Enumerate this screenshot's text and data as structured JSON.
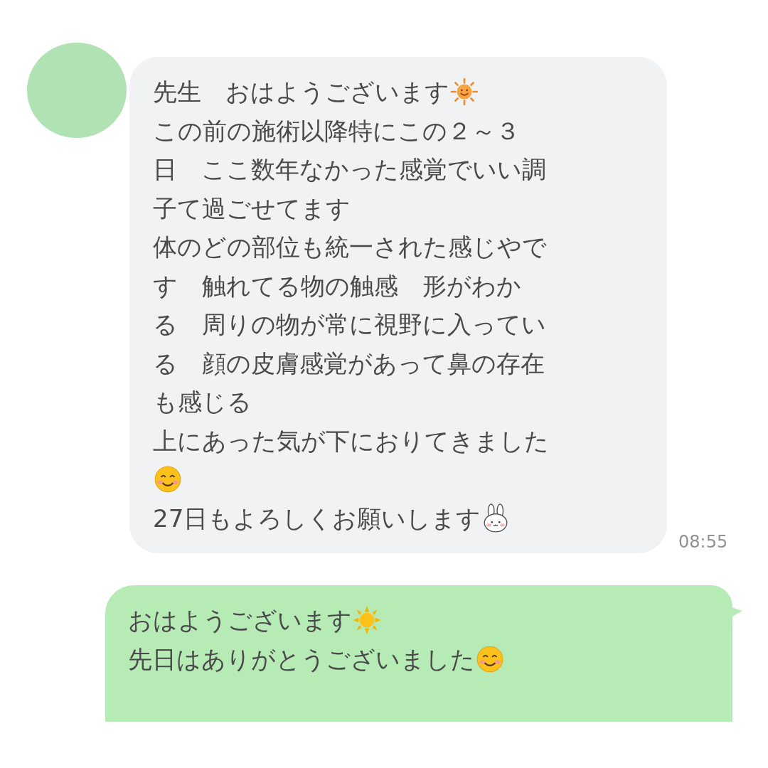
{
  "messages": [
    {
      "kind": "incoming",
      "time": "08:55",
      "lines": [
        [
          {
            "kind": "text",
            "text": "先生　おはようございます"
          },
          {
            "kind": "sun-face"
          }
        ],
        [
          {
            "kind": "text",
            "text": "この前の施術以降特にこの２～３"
          }
        ],
        [
          {
            "kind": "text",
            "text": "日　ここ数年なかった感覚でいい調"
          }
        ],
        [
          {
            "kind": "text",
            "text": "子て過ごせてます"
          }
        ],
        [
          {
            "kind": "text",
            "text": "体のどの部位も統一された感じやで"
          }
        ],
        [
          {
            "kind": "text",
            "text": "す　触れてる物の触感　形がわか"
          }
        ],
        [
          {
            "kind": "text",
            "text": "る　周りの物が常に視野に入ってい"
          }
        ],
        [
          {
            "kind": "text",
            "text": "る　顔の皮膚感覚があって鼻の存在"
          }
        ],
        [
          {
            "kind": "text",
            "text": "も感じる"
          }
        ],
        [
          {
            "kind": "text",
            "text": "上にあった気が下におりてきました"
          }
        ],
        [
          {
            "kind": "smile"
          }
        ],
        [
          {
            "kind": "text",
            "text": "27日もよろしくお願いします"
          },
          {
            "kind": "rabbit"
          }
        ]
      ]
    },
    {
      "kind": "outgoing",
      "lines": [
        [
          {
            "kind": "text",
            "text": "おはようございます"
          },
          {
            "kind": "sun"
          }
        ],
        [
          {
            "kind": "text",
            "text": "先日はありがとうございました"
          },
          {
            "kind": "smile"
          }
        ]
      ]
    }
  ]
}
